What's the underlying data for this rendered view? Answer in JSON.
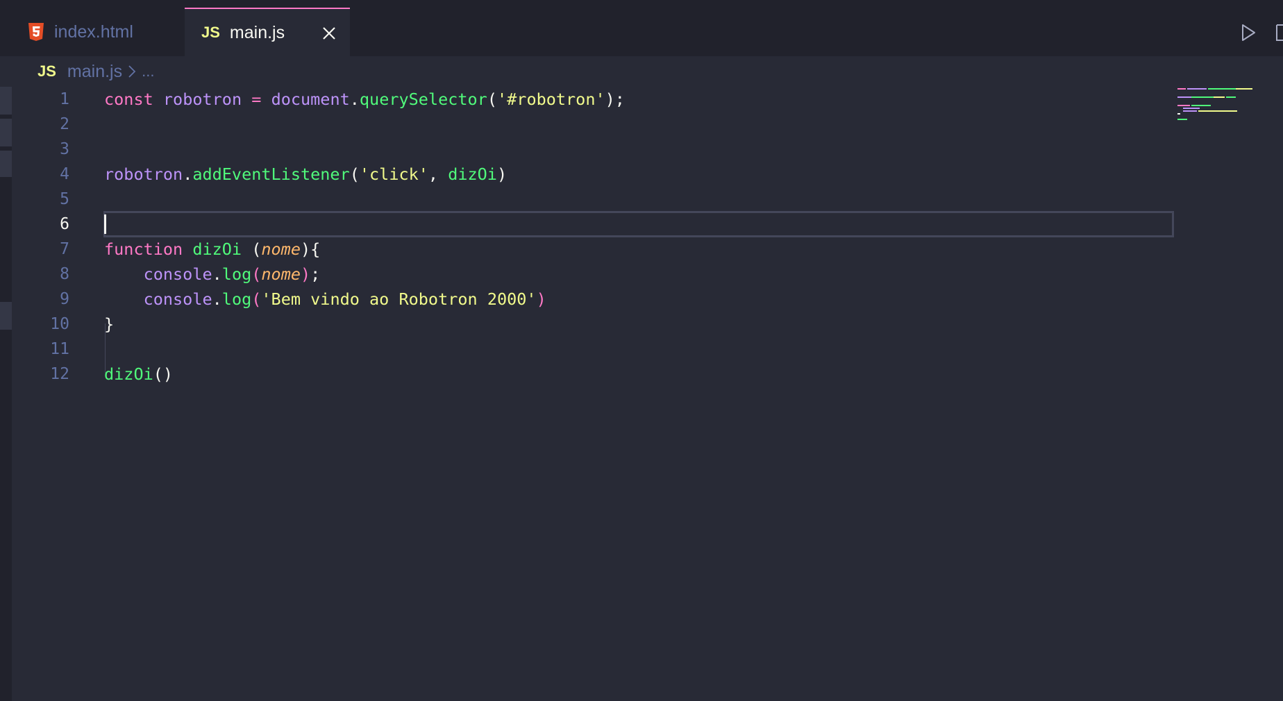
{
  "tabs": [
    {
      "label": "index.html",
      "icon": "html5-icon",
      "active": false
    },
    {
      "label": "main.js",
      "icon": "js-icon",
      "active": true
    }
  ],
  "icons": {
    "js_badge": "JS"
  },
  "breadcrumb": {
    "file": "main.js",
    "more": "..."
  },
  "editor": {
    "active_line": 6,
    "line_numbers": [
      "1",
      "2",
      "3",
      "4",
      "5",
      "6",
      "7",
      "8",
      "9",
      "10",
      "11",
      "12"
    ],
    "lines": [
      [
        {
          "t": "const",
          "c": "kw"
        },
        {
          "t": " ",
          "c": "pl"
        },
        {
          "t": "robotron",
          "c": "var"
        },
        {
          "t": " ",
          "c": "pl"
        },
        {
          "t": "=",
          "c": "op"
        },
        {
          "t": " ",
          "c": "pl"
        },
        {
          "t": "document",
          "c": "var"
        },
        {
          "t": ".",
          "c": "pl"
        },
        {
          "t": "querySelector",
          "c": "fn"
        },
        {
          "t": "(",
          "c": "pl"
        },
        {
          "t": "'#robotron'",
          "c": "str"
        },
        {
          "t": ");",
          "c": "pl"
        }
      ],
      [],
      [],
      [
        {
          "t": "robotron",
          "c": "var"
        },
        {
          "t": ".",
          "c": "pl"
        },
        {
          "t": "addEventListener",
          "c": "fn"
        },
        {
          "t": "(",
          "c": "pl"
        },
        {
          "t": "'click'",
          "c": "str"
        },
        {
          "t": ", ",
          "c": "pl"
        },
        {
          "t": "dizOi",
          "c": "fn"
        },
        {
          "t": ")",
          "c": "pl"
        }
      ],
      [],
      [],
      [
        {
          "t": "function",
          "c": "kw"
        },
        {
          "t": " ",
          "c": "pl"
        },
        {
          "t": "dizOi",
          "c": "fn"
        },
        {
          "t": " (",
          "c": "pl"
        },
        {
          "t": "nome",
          "c": "param"
        },
        {
          "t": "){",
          "c": "pl"
        }
      ],
      [
        {
          "t": "    ",
          "c": "pl"
        },
        {
          "t": "console",
          "c": "var"
        },
        {
          "t": ".",
          "c": "pl"
        },
        {
          "t": "log",
          "c": "fn"
        },
        {
          "t": "(",
          "c": "br2"
        },
        {
          "t": "nome",
          "c": "param"
        },
        {
          "t": ")",
          "c": "br2"
        },
        {
          "t": ";",
          "c": "pl"
        }
      ],
      [
        {
          "t": "    ",
          "c": "pl"
        },
        {
          "t": "console",
          "c": "var"
        },
        {
          "t": ".",
          "c": "pl"
        },
        {
          "t": "log",
          "c": "fn"
        },
        {
          "t": "(",
          "c": "br2"
        },
        {
          "t": "'Bem vindo ao Robotron 2000'",
          "c": "str"
        },
        {
          "t": ")",
          "c": "br2"
        }
      ],
      [
        {
          "t": "}",
          "c": "pl"
        }
      ],
      [],
      [
        {
          "t": "dizOi",
          "c": "fn"
        },
        {
          "t": "()",
          "c": "pl"
        }
      ]
    ]
  },
  "colors": {
    "background": "#282a36",
    "tabbar": "#21222c",
    "keyword": "#ff79c6",
    "variable": "#bd93f9",
    "function": "#50fa7b",
    "string": "#f1fa8c",
    "parameter": "#ffb86c",
    "line_number": "#6272a4"
  }
}
